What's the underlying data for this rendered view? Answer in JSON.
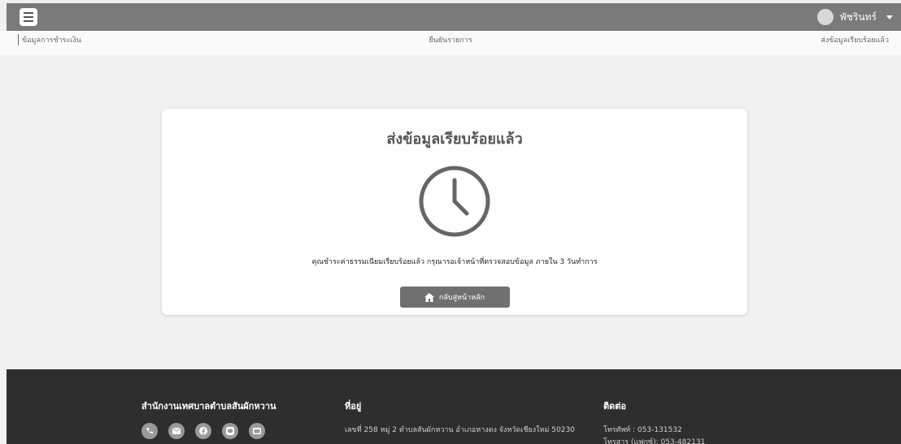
{
  "header": {
    "user_name": "พัชรินทร์"
  },
  "stepper": {
    "steps": [
      {
        "label": "ข้อมูลการชำระเงิน"
      },
      {
        "label": "ยืนยันรายการ"
      },
      {
        "label": "ส่งข้อมูลเรียบร้อยแล้ว"
      }
    ]
  },
  "card": {
    "title": "ส่งข้อมูลเรียบร้อยแล้ว",
    "icon": "clock-icon",
    "message": "คุณชำระค่าธรรมเนียมเรียบร้อยแล้ว กรุณารอเจ้าหน้าที่ตรวจสอบข้อมูล ภายใน 3 วันทำการ",
    "home_button_label": "กลับสู่หน้าหลัก",
    "home_button_icon": "home-icon"
  },
  "footer": {
    "org_name": "สำนักงานเทศบาลตำบลสันผักหวาน",
    "address_title": "ที่อยู่",
    "address": "เลขที่ 258 หมู่ 2 ตำบลสันผักหวาน อำเภอหางดง จังหวัดเชียงใหม่ 50230",
    "contact_title": "ติดต่อ",
    "phone": "โทรศัพท์ : 053-131532",
    "fax": "โทรสาร (แฟกซ์): 053-482131",
    "social_icons": [
      "phone-icon",
      "mail-icon",
      "facebook-icon",
      "line-icon",
      "web-icon"
    ]
  },
  "colors": {
    "topbar": "#7a7a7a",
    "footer": "#2e2e2e",
    "button": "#707070"
  }
}
